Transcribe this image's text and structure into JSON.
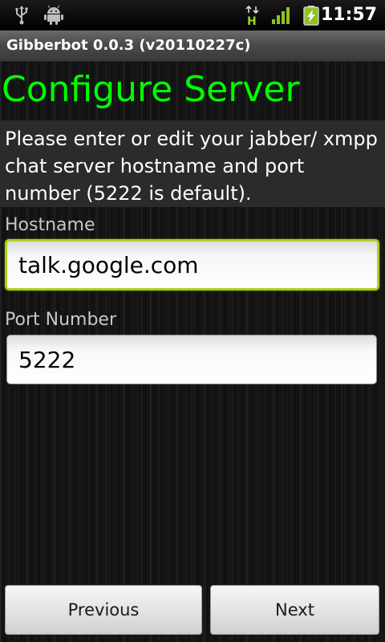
{
  "status_bar": {
    "time": "11:57",
    "icons": [
      "usb-icon",
      "android-debug-icon",
      "network-h-icon",
      "signal-icon",
      "battery-charging-icon"
    ]
  },
  "title_bar": {
    "title": "Gibberbot 0.0.3 (v20110227c)"
  },
  "main": {
    "heading": "Configure Server",
    "description": "Please enter or edit your jabber/ xmpp chat server hostname and port number (5222 is default).",
    "hostname": {
      "label": "Hostname",
      "value": "talk.google.com"
    },
    "port": {
      "label": "Port Number",
      "value": "5222"
    }
  },
  "buttons": {
    "previous": "Previous",
    "next": "Next"
  },
  "colors": {
    "heading": "#00ff00",
    "focus_border": "#a9d11c",
    "signal": "#8fc31f"
  }
}
